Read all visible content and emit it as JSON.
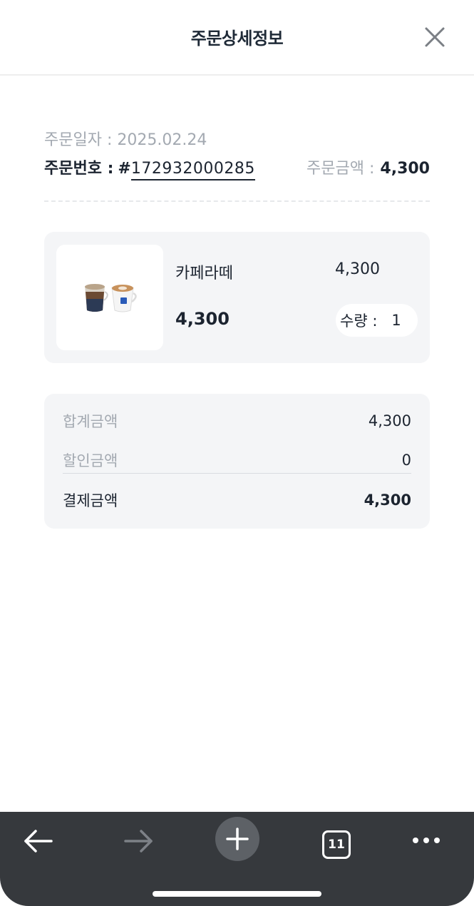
{
  "header": {
    "title": "주문상세정보"
  },
  "order": {
    "date_text": "주문일자 : 2025.02.24",
    "number_label": "주문번호 :",
    "number_hash": "#",
    "number_value": "172932000285",
    "amount_label": "주문금액 :",
    "amount_value": "4,300"
  },
  "product": {
    "name": "카페라떼",
    "unit_price": "4,300",
    "price": "4,300",
    "quantity_label": "수량 :",
    "quantity": "1"
  },
  "summary": {
    "subtotal_label": "합계금액",
    "subtotal_value": "4,300",
    "discount_label": "할인금액",
    "discount_value": "0",
    "total_label": "결제금액",
    "total_value": "4,300"
  },
  "browser": {
    "tab_count": "11",
    "icons": [
      "back-arrow-icon",
      "forward-arrow-icon",
      "plus-icon",
      "tabs-icon",
      "more-dots-icon"
    ]
  },
  "colors": {
    "text_primary": "#1c2430",
    "text_muted": "#a3a9b1",
    "card_bg": "#f4f5f7",
    "browser_bar": "#36393d"
  }
}
